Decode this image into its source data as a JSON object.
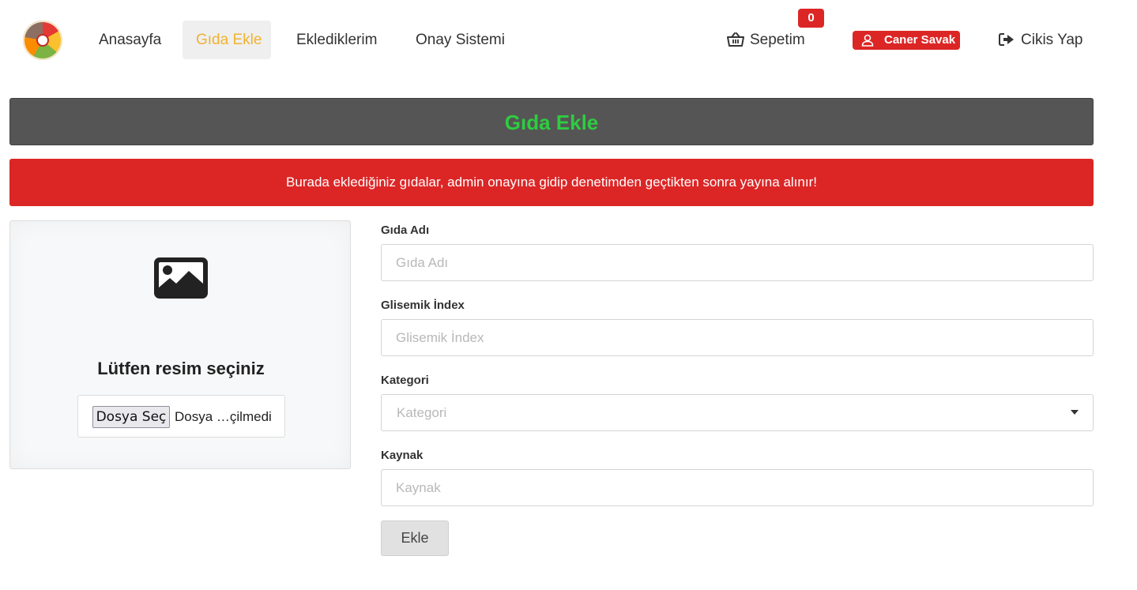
{
  "nav": {
    "logo_icon": "food-wheel-logo-icon",
    "links": [
      {
        "label": "Anasayfa"
      },
      {
        "label": "Gıda Ekle",
        "active": true
      },
      {
        "label": "Eklediklerim"
      },
      {
        "label": "Onay Sistemi"
      }
    ],
    "cart": {
      "label": "Sepetim",
      "count": "0",
      "icon": "basket-icon"
    },
    "user": {
      "name": "Caner Savak",
      "icon": "user-icon"
    },
    "logout": {
      "label": "Cikis Yap",
      "icon": "sign-out-icon"
    }
  },
  "page": {
    "title": "Gıda Ekle",
    "alert": "Burada eklediğiniz gıdalar, admin onayına gidip denetimden geçtikten sonra yayına alınır!"
  },
  "image_upload": {
    "icon": "image-icon",
    "heading": "Lütfen resim seçiniz",
    "button_label": "Dosya Seç",
    "file_status": "Dosya …çilmedi"
  },
  "form": {
    "name": {
      "label": "Gıda Adı",
      "placeholder": "Gıda Adı",
      "value": ""
    },
    "glycemic": {
      "label": "Glisemik İndex",
      "placeholder": "Glisemik İndex",
      "value": ""
    },
    "category": {
      "label": "Kategori",
      "placeholder": "Kategori"
    },
    "source": {
      "label": "Kaynak",
      "placeholder": "Kaynak",
      "value": ""
    },
    "submit_label": "Ekle"
  },
  "colors": {
    "accent_active": "#f0b232",
    "title_green": "#2ecc40",
    "title_bar": "#555555",
    "alert_red": "#dc2626"
  }
}
